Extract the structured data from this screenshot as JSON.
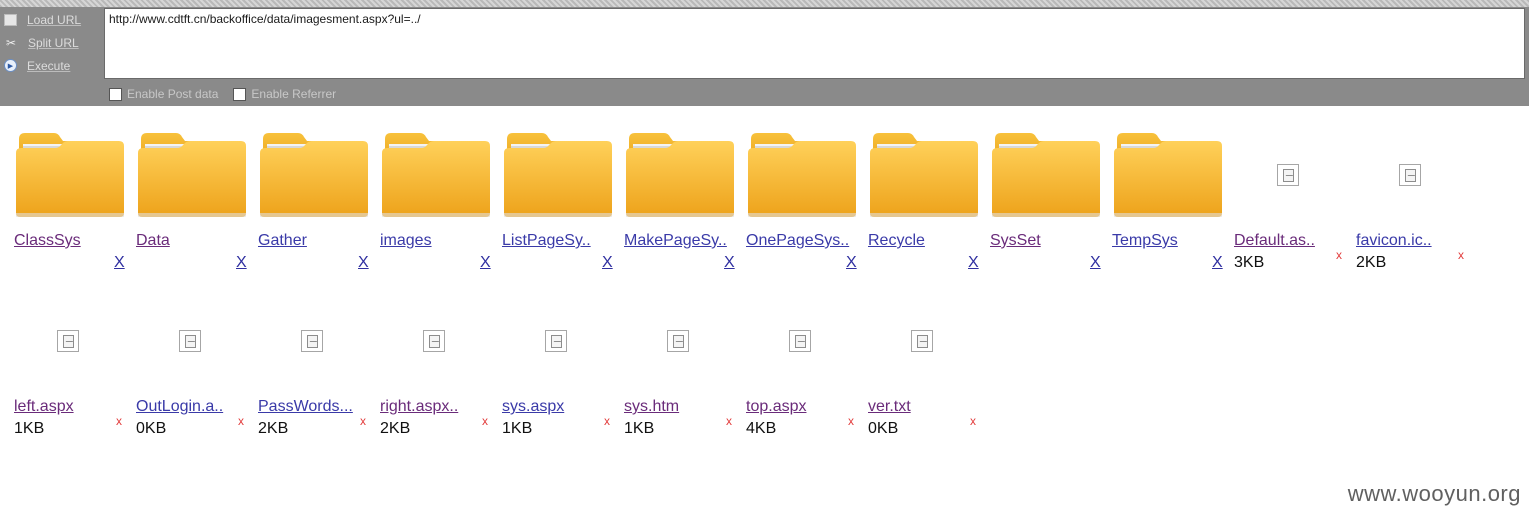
{
  "toolbar": {
    "load_label": "Load URL",
    "split_label": "Split URL",
    "exec_label": "Execute",
    "url": "http://www.cdtft.cn/backoffice/data/imagesment.aspx?ul=../",
    "post_label": "Enable Post data",
    "referrer_label": "Enable Referrer"
  },
  "items": [
    {
      "name": "ClassSys",
      "kind": "folder",
      "del": "X",
      "visited": true
    },
    {
      "name": "Data",
      "kind": "folder",
      "del": "X",
      "visited": true
    },
    {
      "name": "Gather",
      "kind": "folder",
      "del": "X"
    },
    {
      "name": "images",
      "kind": "folder",
      "del": "X"
    },
    {
      "name": "ListPageSy..",
      "kind": "folder",
      "del": "X"
    },
    {
      "name": "MakePageSy..",
      "kind": "folder",
      "del": "X"
    },
    {
      "name": "OnePageSys..",
      "kind": "folder",
      "del": "X"
    },
    {
      "name": "Recycle",
      "kind": "folder",
      "del": "X"
    },
    {
      "name": "SysSet",
      "kind": "folder",
      "del": "X",
      "visited": true
    },
    {
      "name": "TempSys",
      "kind": "folder",
      "del": "X"
    },
    {
      "name": "Default.as..",
      "kind": "file",
      "size": "3KB",
      "del": "x",
      "visited": true
    },
    {
      "name": "favicon.ic..",
      "kind": "file",
      "size": "2KB",
      "del": "x"
    },
    {
      "name": "left.aspx",
      "kind": "file",
      "size": "1KB",
      "del": "x",
      "visited": true
    },
    {
      "name": "OutLogin.a..",
      "kind": "file",
      "size": "0KB",
      "del": "x"
    },
    {
      "name": "PassWords...",
      "kind": "file",
      "size": "2KB",
      "del": "x"
    },
    {
      "name": "right.aspx..",
      "kind": "file",
      "size": "2KB",
      "del": "x",
      "visited": true
    },
    {
      "name": "sys.aspx",
      "kind": "file",
      "size": "1KB",
      "del": "x"
    },
    {
      "name": "sys.htm",
      "kind": "file",
      "size": "1KB",
      "del": "x",
      "visited": true
    },
    {
      "name": "top.aspx",
      "kind": "file",
      "size": "4KB",
      "del": "x",
      "visited": true
    },
    {
      "name": "ver.txt",
      "kind": "file",
      "size": "0KB",
      "del": "x",
      "visited": true
    }
  ],
  "watermark": "www.wooyun.org",
  "colors": {
    "folder": "#f6b524",
    "link": "#3a3aa8",
    "visited": "#6a2b7a",
    "delete_file": "#e23b3b"
  }
}
